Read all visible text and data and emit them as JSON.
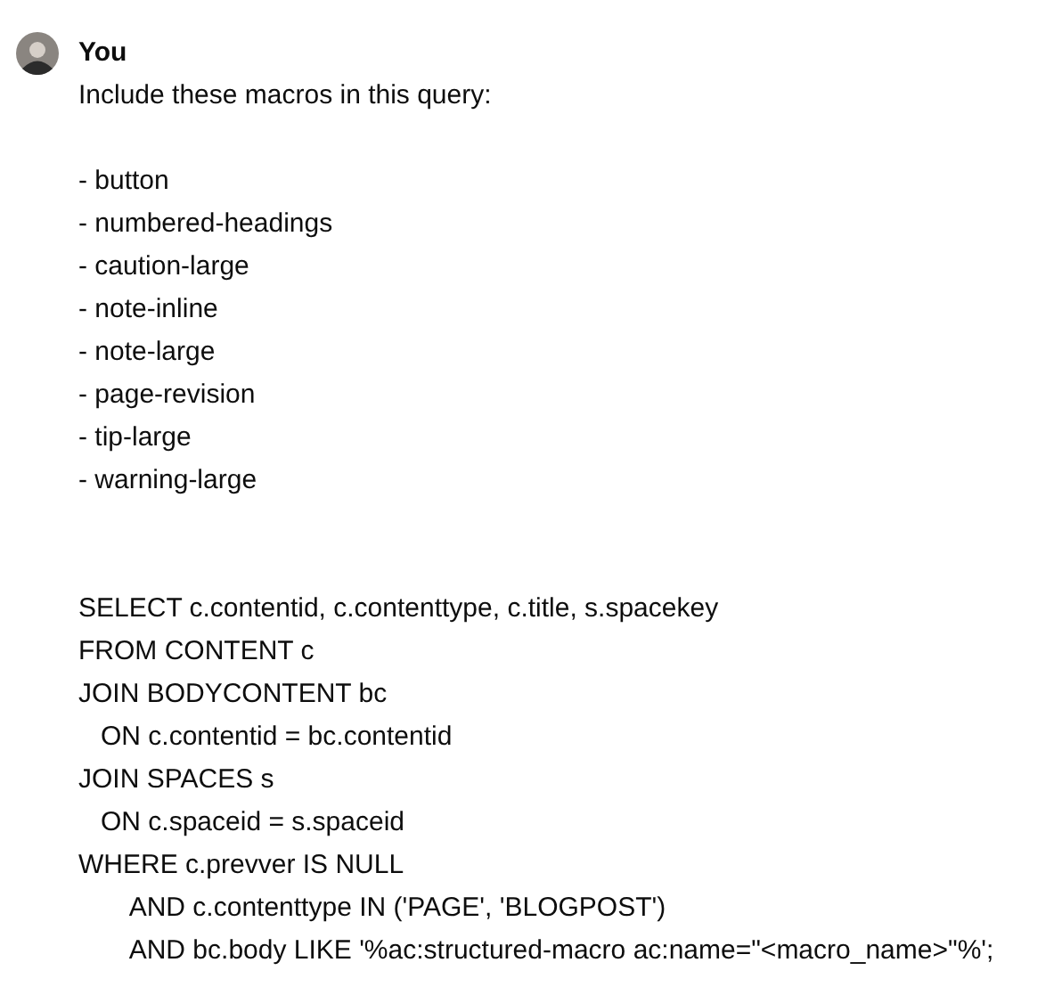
{
  "message": {
    "author": "You",
    "intro": "Include these macros in this query:",
    "list_items": [
      "- button",
      "- numbered-headings",
      "- caution-large",
      "- note-inline",
      "- note-large",
      "- page-revision",
      "- tip-large",
      "- warning-large"
    ],
    "query_lines": [
      "SELECT c.contentid, c.contenttype, c.title, s.spacekey",
      "FROM CONTENT c",
      "JOIN BODYCONTENT bc",
      "   ON c.contentid = bc.contentid",
      "JOIN SPACES s",
      "   ON c.spaceid = s.spaceid",
      "WHERE c.prevver IS NULL",
      "       AND c.contenttype IN ('PAGE', 'BLOGPOST')",
      "       AND bc.body LIKE '%ac:structured-macro ac:name=\"<macro_name>\"%';"
    ]
  }
}
